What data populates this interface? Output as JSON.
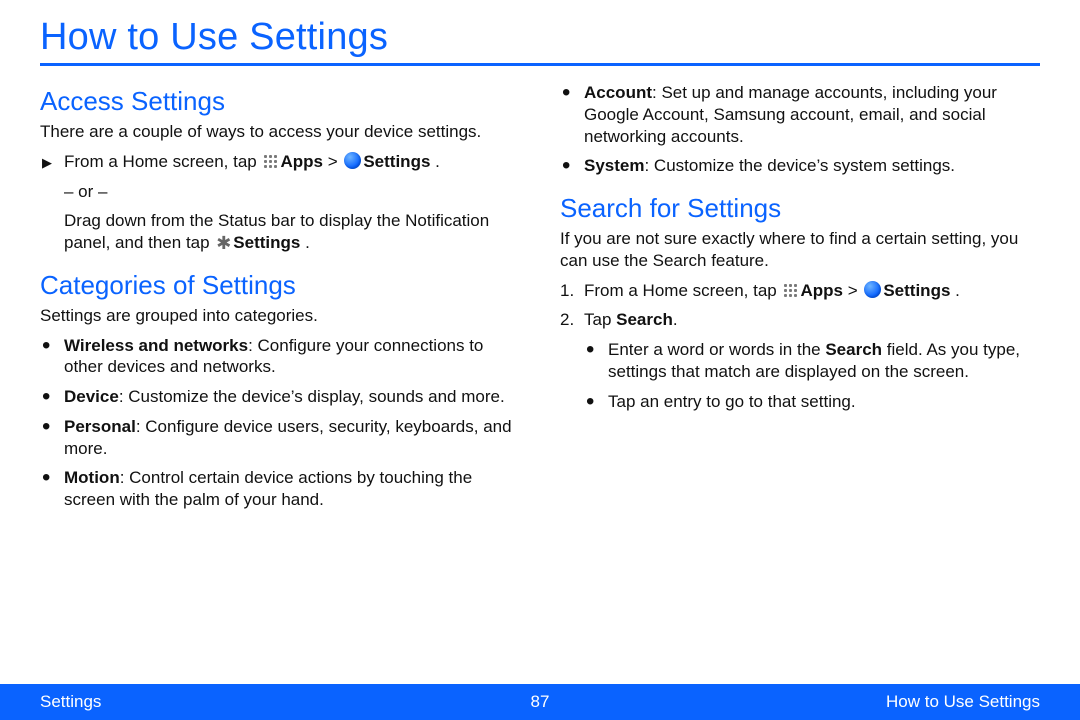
{
  "title": "How to Use Settings",
  "footer": {
    "left": "Settings",
    "page": "87",
    "right": "How to Use Settings"
  },
  "labels": {
    "apps": "Apps",
    "gt": " > ",
    "settings": "Settings",
    "period": " .",
    "or": "– or –",
    "search": "Search"
  },
  "left": {
    "access": {
      "heading": "Access Settings",
      "intro": "There are a couple of ways to access your device settings.",
      "step_prefix": "From a Home screen, tap ",
      "drag": "Drag down from the Status bar to display the Notification panel, and then tap "
    },
    "categories": {
      "heading": "Categories of Settings",
      "intro": "Settings are grouped into categories.",
      "items": [
        {
          "name": "Wireless and networks",
          "desc": ": Configure your connections to other devices and networks."
        },
        {
          "name": "Device",
          "desc": ": Customize the device’s display, sounds and more."
        },
        {
          "name": "Personal",
          "desc": ": Configure device users, security, keyboards, and more."
        },
        {
          "name": "Motion",
          "desc": ": Control certain device actions by touching the screen with the palm of your hand."
        }
      ]
    }
  },
  "right": {
    "more_categories": [
      {
        "name": "Account",
        "desc": ": Set up and manage accounts, including your Google Account, Samsung account, email, and social networking accounts."
      },
      {
        "name": "System",
        "desc": ": Customize the device’s system settings."
      }
    ],
    "search": {
      "heading": "Search for Settings",
      "intro": "If you are not sure exactly where to find a certain setting, you can use the Search feature.",
      "step1_prefix": "From a Home screen, tap ",
      "step2": "Tap ",
      "sub1a": "Enter a word or words in the ",
      "sub1b": " field. As you type, settings that match are displayed on the screen.",
      "sub2": "Tap an entry to go to that setting."
    }
  }
}
